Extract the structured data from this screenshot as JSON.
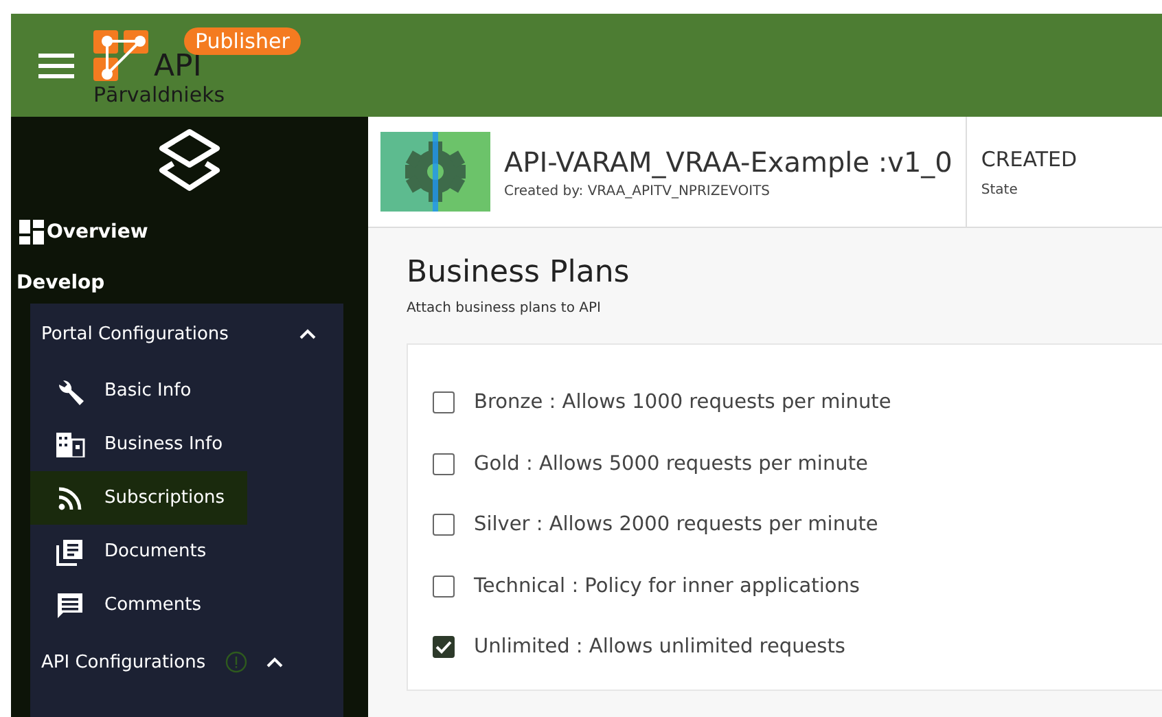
{
  "header": {
    "badge": "Publisher",
    "logo_title": "API",
    "logo_subtitle": "Pārvaldnieks"
  },
  "sidebar": {
    "overview": "Overview",
    "section": "Develop",
    "groups": [
      {
        "label": "Portal Configurations",
        "expanded": true,
        "info": false,
        "items": [
          {
            "label": "Basic Info",
            "selected": false
          },
          {
            "label": "Business Info",
            "selected": false
          },
          {
            "label": "Subscriptions",
            "selected": true
          },
          {
            "label": "Documents",
            "selected": false
          },
          {
            "label": "Comments",
            "selected": false
          }
        ]
      },
      {
        "label": "API Configurations",
        "expanded": true,
        "info": true
      }
    ]
  },
  "api": {
    "name": "API-VARAM_VRAA-Example :v1_0",
    "created_by": "Created by: VRAA_APITV_NPRIZEVOITS",
    "state": "CREATED",
    "state_label": "State"
  },
  "page": {
    "title": "Business Plans",
    "subtitle": "Attach business plans to API"
  },
  "plans": [
    {
      "label": "Bronze : Allows 1000 requests per minute",
      "checked": false
    },
    {
      "label": "Gold : Allows 5000 requests per minute",
      "checked": false
    },
    {
      "label": "Silver : Allows 2000 requests per minute",
      "checked": false
    },
    {
      "label": "Technical : Policy for inner applications",
      "checked": false
    },
    {
      "label": "Unlimited : Allows unlimited requests",
      "checked": true
    }
  ]
}
